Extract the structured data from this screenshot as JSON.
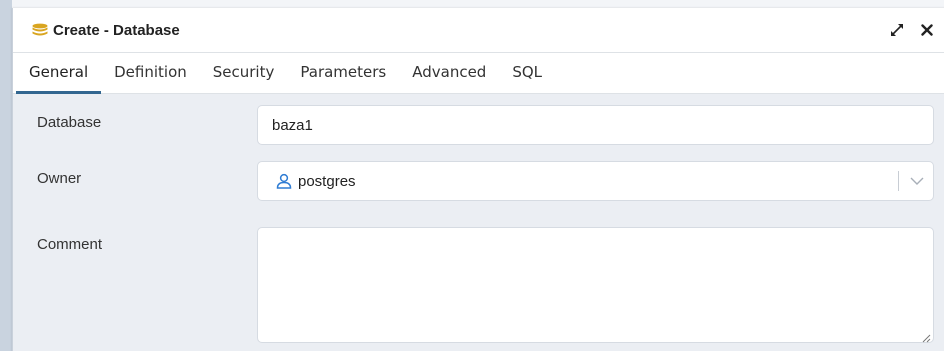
{
  "dialog": {
    "title": "Create - Database",
    "icons": {
      "database": "database-icon",
      "maximize": "maximize-icon",
      "close": "close-icon"
    }
  },
  "tabs": [
    {
      "label": "General",
      "active": true
    },
    {
      "label": "Definition",
      "active": false
    },
    {
      "label": "Security",
      "active": false
    },
    {
      "label": "Parameters",
      "active": false
    },
    {
      "label": "Advanced",
      "active": false
    },
    {
      "label": "SQL",
      "active": false
    }
  ],
  "form": {
    "database": {
      "label": "Database",
      "value": "baza1"
    },
    "owner": {
      "label": "Owner",
      "value": "postgres"
    },
    "comment": {
      "label": "Comment",
      "value": ""
    }
  },
  "colors": {
    "accent": "#326690",
    "db_icon": "#d9a520",
    "user_icon": "#2f7cd3"
  }
}
